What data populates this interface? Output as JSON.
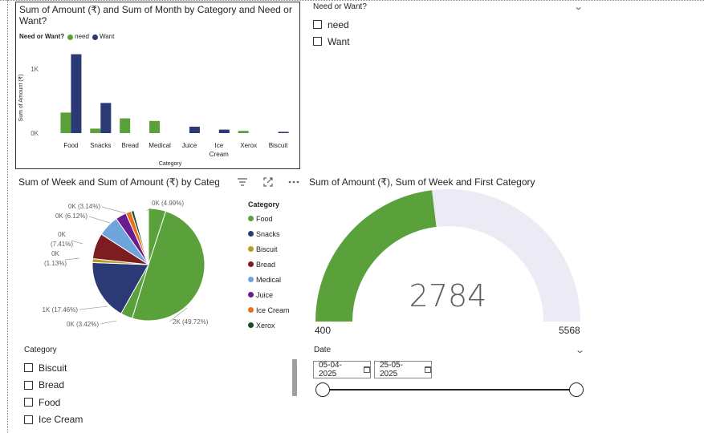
{
  "bar_visual": {
    "title": "Sum of Amount (₹) and Sum of Month by Category and Need or Want?",
    "legend_title": "Need or Want?",
    "chart_data": {
      "type": "bar",
      "xlabel": "Category",
      "ylabel": "Sum of Amount (₹)",
      "ylim": [
        0,
        1350
      ],
      "yticks": [
        {
          "value": 0,
          "label": "0K"
        },
        {
          "value": 1000,
          "label": "1K"
        }
      ],
      "categories": [
        "Food",
        "Snacks",
        "Bread",
        "Medical",
        "Juice",
        "Ice Cream",
        "Xerox",
        "Biscuit"
      ],
      "series": [
        {
          "name": "need",
          "color": "#5aa13b",
          "values": [
            320,
            70,
            230,
            190,
            0,
            0,
            35,
            0
          ]
        },
        {
          "name": "Want",
          "color": "#2b3a74",
          "values": [
            1230,
            470,
            0,
            0,
            100,
            55,
            0,
            20
          ]
        }
      ]
    }
  },
  "need_slicer": {
    "title": "Need or Want?",
    "options": [
      "need",
      "Want"
    ]
  },
  "pie_visual": {
    "title": "Sum of Week and Sum of Amount (₹) by Category",
    "header_icons": [
      "filter-icon",
      "focus-mode-icon",
      "more-options-icon"
    ],
    "legend_title": "Category",
    "chart_data": {
      "type": "pie",
      "slices": [
        {
          "category": "Food",
          "percent": 49.72,
          "label": "2K (49.72%)",
          "color": "#5aa13b"
        },
        {
          "category": "Snacks",
          "percent": 17.46,
          "label": "1K (17.46%)",
          "color": "#2b3a74"
        },
        {
          "category": "Biscuit",
          "percent": 1.13,
          "label": "0K\n(1.13%)",
          "color": "#b79f26"
        },
        {
          "category": "Bread",
          "percent": 7.41,
          "label": "0K\n(7.41%)",
          "color": "#7d1c21"
        },
        {
          "category": "Medical",
          "percent": 6.12,
          "label": "0K (6.12%)",
          "color": "#6ea6dc"
        },
        {
          "category": "Juice",
          "percent": 3.14,
          "label": "0K (3.14%)",
          "color": "#6a1b8f"
        },
        {
          "category": "Ice Cream",
          "percent": 1.6,
          "label": "",
          "color": "#e8721c"
        },
        {
          "category": "Xerox",
          "percent": 0.78,
          "label": "",
          "color": "#1b4d2a"
        },
        {
          "category": "(other)",
          "percent": 3.42,
          "label": "0K (3.42%)",
          "color": "#5aa13b"
        },
        {
          "category": "(other)",
          "percent": 4.99,
          "label": "0K (4.99%)",
          "color": "#5aa13b"
        }
      ],
      "legend": [
        "Food",
        "Snacks",
        "Biscuit",
        "Bread",
        "Medical",
        "Juice",
        "Ice Cream",
        "Xerox"
      ],
      "legend_colors": [
        "#5aa13b",
        "#2b3a74",
        "#b79f26",
        "#7d1c21",
        "#6ea6dc",
        "#6a1b8f",
        "#e8721c",
        "#1b4d2a"
      ]
    }
  },
  "gauge_visual": {
    "title": "Sum of Amount (₹), Sum of Week and First Category",
    "value": 2784,
    "value_label": "2784",
    "min": 400,
    "min_label": "400",
    "max": 5568,
    "max_label": "5568",
    "fill_color": "#5aa13b",
    "track_color": "#ecebf5"
  },
  "category_slicer": {
    "title": "Category",
    "options": [
      "Biscuit",
      "Bread",
      "Food",
      "Ice Cream"
    ]
  },
  "date_slicer": {
    "title": "Date",
    "start": "05-04-2025",
    "end": "25-05-2025"
  }
}
